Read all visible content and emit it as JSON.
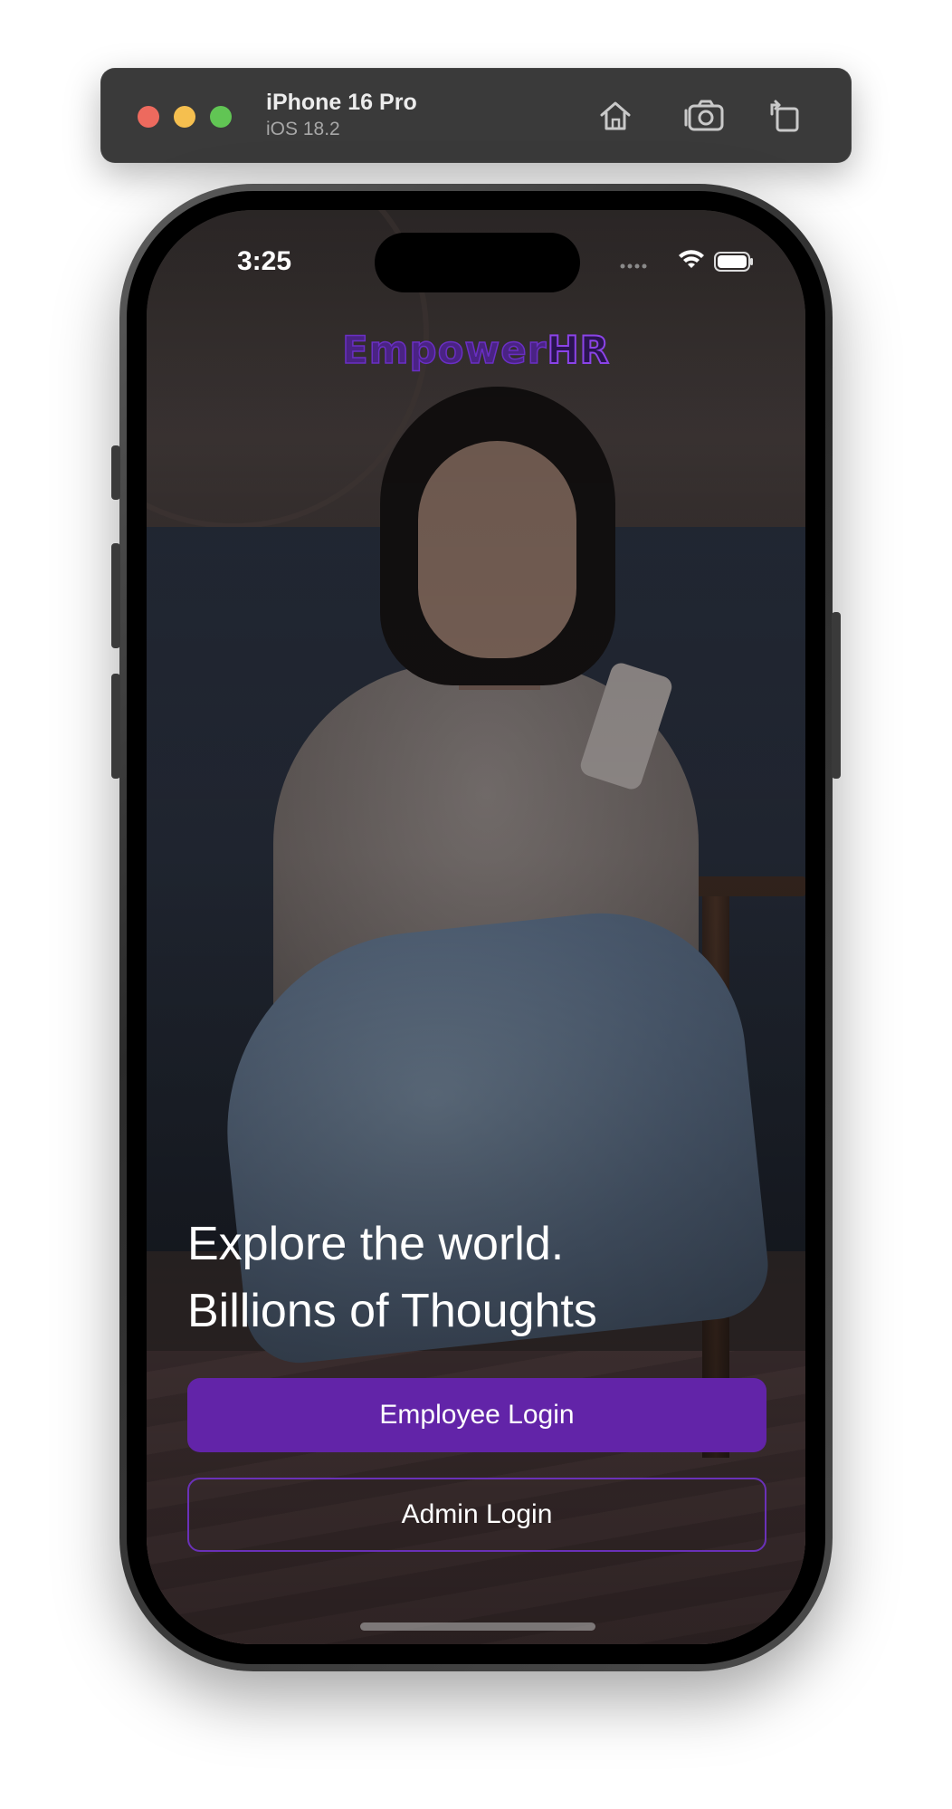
{
  "simulator": {
    "device_name": "iPhone 16 Pro",
    "os_version": "iOS 18.2",
    "toolbar_icons": [
      "home-icon",
      "screenshot-icon",
      "rotate-icon"
    ]
  },
  "status_bar": {
    "time": "3:25",
    "icons": [
      "signal-icon",
      "wifi-icon",
      "battery-icon"
    ]
  },
  "app": {
    "logo": {
      "part1": "Empower",
      "part2": "HR"
    },
    "headline": {
      "line1": "Explore the world.",
      "line2": "Billions of Thoughts"
    },
    "buttons": {
      "employee_login": "Employee Login",
      "admin_login": "Admin Login"
    },
    "colors": {
      "primary_purple": "#6224a8",
      "outline_purple": "#6a31b8",
      "logo_purple": "#8b43e8"
    }
  }
}
